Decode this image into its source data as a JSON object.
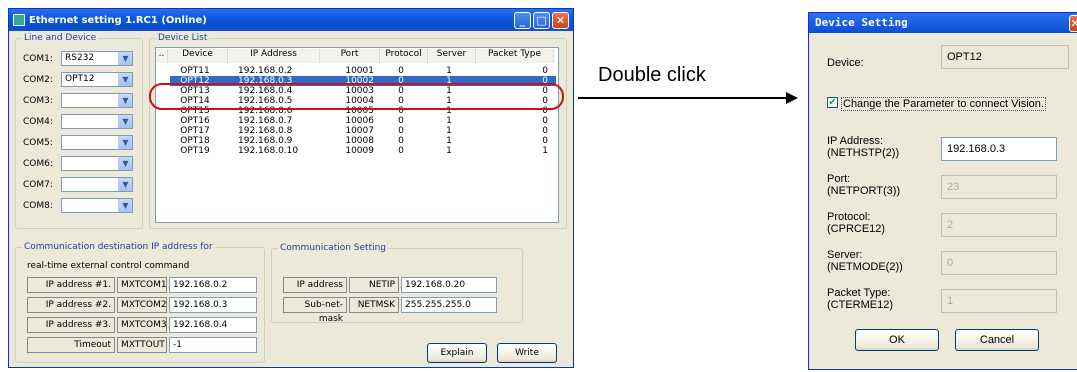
{
  "main_window": {
    "title": "Ethernet setting 1.RC1 (Online)",
    "line_group": "Line and Device",
    "com_rows": [
      {
        "label": "COM1:",
        "value": "RS232"
      },
      {
        "label": "COM2:",
        "value": "OPT12"
      },
      {
        "label": "COM3:",
        "value": ""
      },
      {
        "label": "COM4:",
        "value": ""
      },
      {
        "label": "COM5:",
        "value": ""
      },
      {
        "label": "COM6:",
        "value": ""
      },
      {
        "label": "COM7:",
        "value": ""
      },
      {
        "label": "COM8:",
        "value": ""
      }
    ],
    "device_list_group": "Device List",
    "columns": [
      "..",
      "Device",
      "IP Address",
      "Port",
      "Protocol",
      "Server",
      "Packet Type"
    ],
    "rows": [
      [
        "OPT11",
        "192.168.0.2",
        "10001",
        "0",
        "1",
        "0"
      ],
      [
        "OPT12",
        "192.168.0.3",
        "10002",
        "0",
        "1",
        "0"
      ],
      [
        "OPT13",
        "192.168.0.4",
        "10003",
        "0",
        "1",
        "0"
      ],
      [
        "OPT14",
        "192.168.0.5",
        "10004",
        "0",
        "1",
        "0"
      ],
      [
        "OPT15",
        "192.168.0.6",
        "10005",
        "0",
        "1",
        "0"
      ],
      [
        "OPT16",
        "192.168.0.7",
        "10006",
        "0",
        "1",
        "0"
      ],
      [
        "OPT17",
        "192.168.0.8",
        "10007",
        "0",
        "1",
        "0"
      ],
      [
        "OPT18",
        "192.168.0.9",
        "10008",
        "0",
        "1",
        "0"
      ],
      [
        "OPT19",
        "192.168.0.10",
        "10009",
        "0",
        "1",
        "1"
      ]
    ],
    "selected_row": 1,
    "comm_dest_group_line1": "Communication destination IP address for",
    "comm_dest_group_line2": "real-time external control command",
    "dest_rows": [
      {
        "label": "IP address #1.",
        "param": "MXTCOM1",
        "value": "192.168.0.2"
      },
      {
        "label": "IP address #2.",
        "param": "MXTCOM2",
        "value": "192.168.0.3"
      },
      {
        "label": "IP address #3.",
        "param": "MXTCOM3",
        "value": "192.168.0.4"
      },
      {
        "label": "Timeout",
        "param": "MXTTOUT",
        "value": "-1"
      }
    ],
    "comm_setting_group": "Communication Setting",
    "comm_rows": [
      {
        "label": "IP address",
        "param": "NETIP",
        "value": "192.168.0.20"
      },
      {
        "label": "Sub-net-mask",
        "param": "NETMSK",
        "value": "255.255.255.0"
      }
    ],
    "explain_label": "Explain",
    "write_label": "Write"
  },
  "annotation": {
    "double_click_label": "Double click"
  },
  "dialog": {
    "title": "Device Setting",
    "device_label": "Device:",
    "device_value": "OPT12",
    "checkbox_label": "Change the Parameter to connect Vision.",
    "checked": true,
    "fields": [
      {
        "label1": "IP Address:",
        "label2": "(NETHSTP(2))",
        "value": "192.168.0.3",
        "enabled": true
      },
      {
        "label1": "Port:",
        "label2": "(NETPORT(3))",
        "value": "23",
        "enabled": false
      },
      {
        "label1": "Protocol:",
        "label2": "(CPRCE12)",
        "value": "2",
        "enabled": false
      },
      {
        "label1": "Server:",
        "label2": "(NETMODE(2))",
        "value": "0",
        "enabled": false
      },
      {
        "label1": "Packet Type:",
        "label2": "(CTERME12)",
        "value": "1",
        "enabled": false
      }
    ],
    "ok_label": "OK",
    "cancel_label": "Cancel"
  },
  "colors": {
    "selection": "#316ac5",
    "highlight_ring": "#d01010",
    "titlebar": "#0b58e0"
  }
}
